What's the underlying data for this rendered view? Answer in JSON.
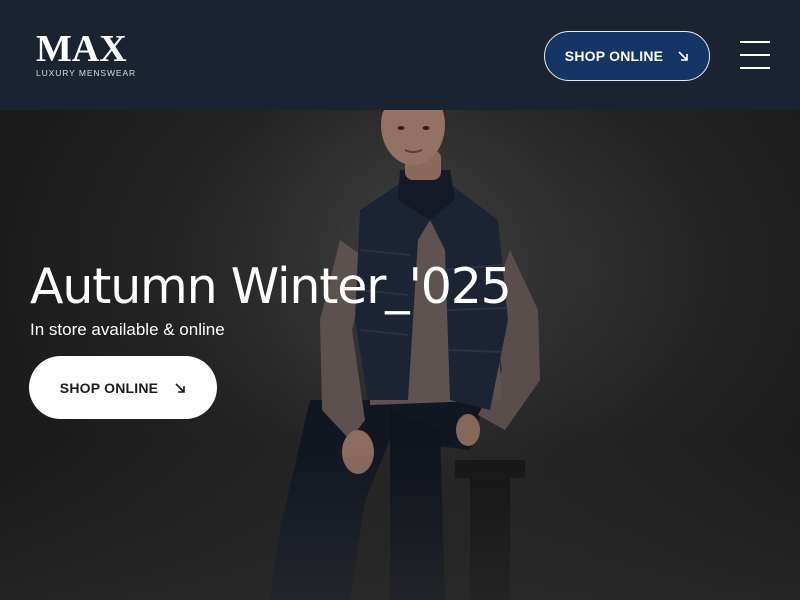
{
  "header": {
    "logo": {
      "wordmark": "MAX",
      "tagline": "LUXURY MENSWEAR"
    },
    "cta_label": "SHOP ONLINE",
    "cta_icon": "arrow-down-right-icon",
    "menu_icon": "hamburger-menu-icon"
  },
  "hero": {
    "title": "Autumn Winter_'025",
    "subtitle": "In store available & online",
    "cta_label": "SHOP ONLINE",
    "cta_icon": "arrow-down-right-icon",
    "image": "model-in-puffer-vest-photo"
  },
  "colors": {
    "header_bg": "#1c2330",
    "header_cta_bg": "#153565",
    "hero_cta_bg": "#ffffff",
    "hero_bg": "#1f1f1f"
  }
}
